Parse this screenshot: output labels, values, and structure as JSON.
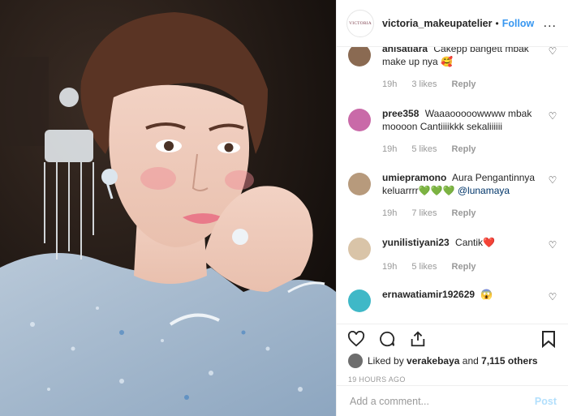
{
  "header": {
    "avatar_text": "VICTORIA",
    "username": "victoria_makeupatelier",
    "separator": "•",
    "follow_label": "Follow",
    "more_label": "..."
  },
  "comments": [
    {
      "user": "anisatiara",
      "text": "Cakepp bangett mbak make up nya 🥰",
      "time": "19h",
      "likes": "3 likes",
      "reply": "Reply",
      "avatar_color": "#8a6a52"
    },
    {
      "user": "pree358",
      "text": "Waaaooooowwww mbak moooon Cantiiiikkk sekaliiiiii",
      "time": "19h",
      "likes": "5 likes",
      "reply": "Reply",
      "avatar_color": "#c96aa8"
    },
    {
      "user": "umiepramono",
      "text": "Aura Pengantinnya keluarrrr💚💚💚",
      "mention": "@lunamaya",
      "time": "19h",
      "likes": "7 likes",
      "reply": "Reply",
      "avatar_color": "#b79a7c"
    },
    {
      "user": "yunilistiyani23",
      "text": "Cantik❤️",
      "time": "19h",
      "likes": "5 likes",
      "reply": "Reply",
      "avatar_color": "#d9c4a8"
    },
    {
      "user": "ernawatiamir192629",
      "text": "😱",
      "time": "",
      "likes": "",
      "reply": "",
      "avatar_color": "#3fb8c7"
    }
  ],
  "likes": {
    "prefix": "Liked by",
    "user": "verakebaya",
    "and": "and",
    "others": "7,115 others"
  },
  "timestamp": "19 HOURS AGO",
  "add_comment": {
    "placeholder": "Add a comment...",
    "post_label": "Post"
  },
  "icons": {
    "like": "heart-icon",
    "comment": "comment-icon",
    "share": "share-icon",
    "save": "bookmark-icon"
  }
}
